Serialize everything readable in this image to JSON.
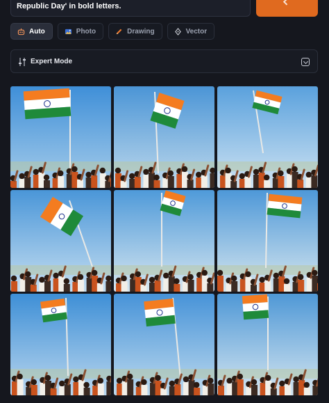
{
  "prompt": {
    "text": "Republic Day' in bold letters."
  },
  "modes": [
    {
      "label": "Auto",
      "icon": "robot-icon",
      "active": true
    },
    {
      "label": "Photo",
      "icon": "image-icon",
      "active": false
    },
    {
      "label": "Drawing",
      "icon": "pencil-icon",
      "active": false
    },
    {
      "label": "Vector",
      "icon": "pen-nib-icon",
      "active": false
    }
  ],
  "expert_mode": {
    "label": "Expert Mode",
    "icon": "sliders-icon",
    "toggle_icon": "chevron-down-icon"
  },
  "colors": {
    "accent": "#e06a1f",
    "background": "#15171e",
    "saffron": "#f47c20",
    "green": "#1f8a3a",
    "chakra": "#1a2f8c"
  },
  "results": [
    {
      "name": "result-image-1",
      "sky": [
        "#3f8fd8",
        "#a7cdea"
      ],
      "flag": "upper-left",
      "flip": false
    },
    {
      "name": "result-image-2",
      "sky": [
        "#4b95d6",
        "#bfd9ec"
      ],
      "flag": "mid-center",
      "flip": false
    },
    {
      "name": "result-image-3",
      "sky": [
        "#5aa1dd",
        "#cfe3f2"
      ],
      "flag": "upper-right",
      "flip": false
    },
    {
      "name": "result-image-4",
      "sky": [
        "#4a96d8",
        "#c5def1"
      ],
      "flag": "diag-left",
      "flip": true
    },
    {
      "name": "result-image-5",
      "sky": [
        "#4f9ad9",
        "#d6e6f0"
      ],
      "flag": "top-center",
      "flip": false
    },
    {
      "name": "result-image-6",
      "sky": [
        "#4e98d8",
        "#d7e7ef"
      ],
      "flag": "top-right",
      "flip": false
    },
    {
      "name": "result-image-7",
      "sky": [
        "#3e8fd6",
        "#b9d6ee"
      ],
      "flag": "mid-left",
      "flip": false
    },
    {
      "name": "result-image-8",
      "sky": [
        "#4793d8",
        "#bcd9ee"
      ],
      "flag": "mid-center2",
      "flip": false
    },
    {
      "name": "result-image-9",
      "sky": [
        "#4f98d6",
        "#d4e5f0"
      ],
      "flag": "top-center2",
      "flip": false
    }
  ]
}
